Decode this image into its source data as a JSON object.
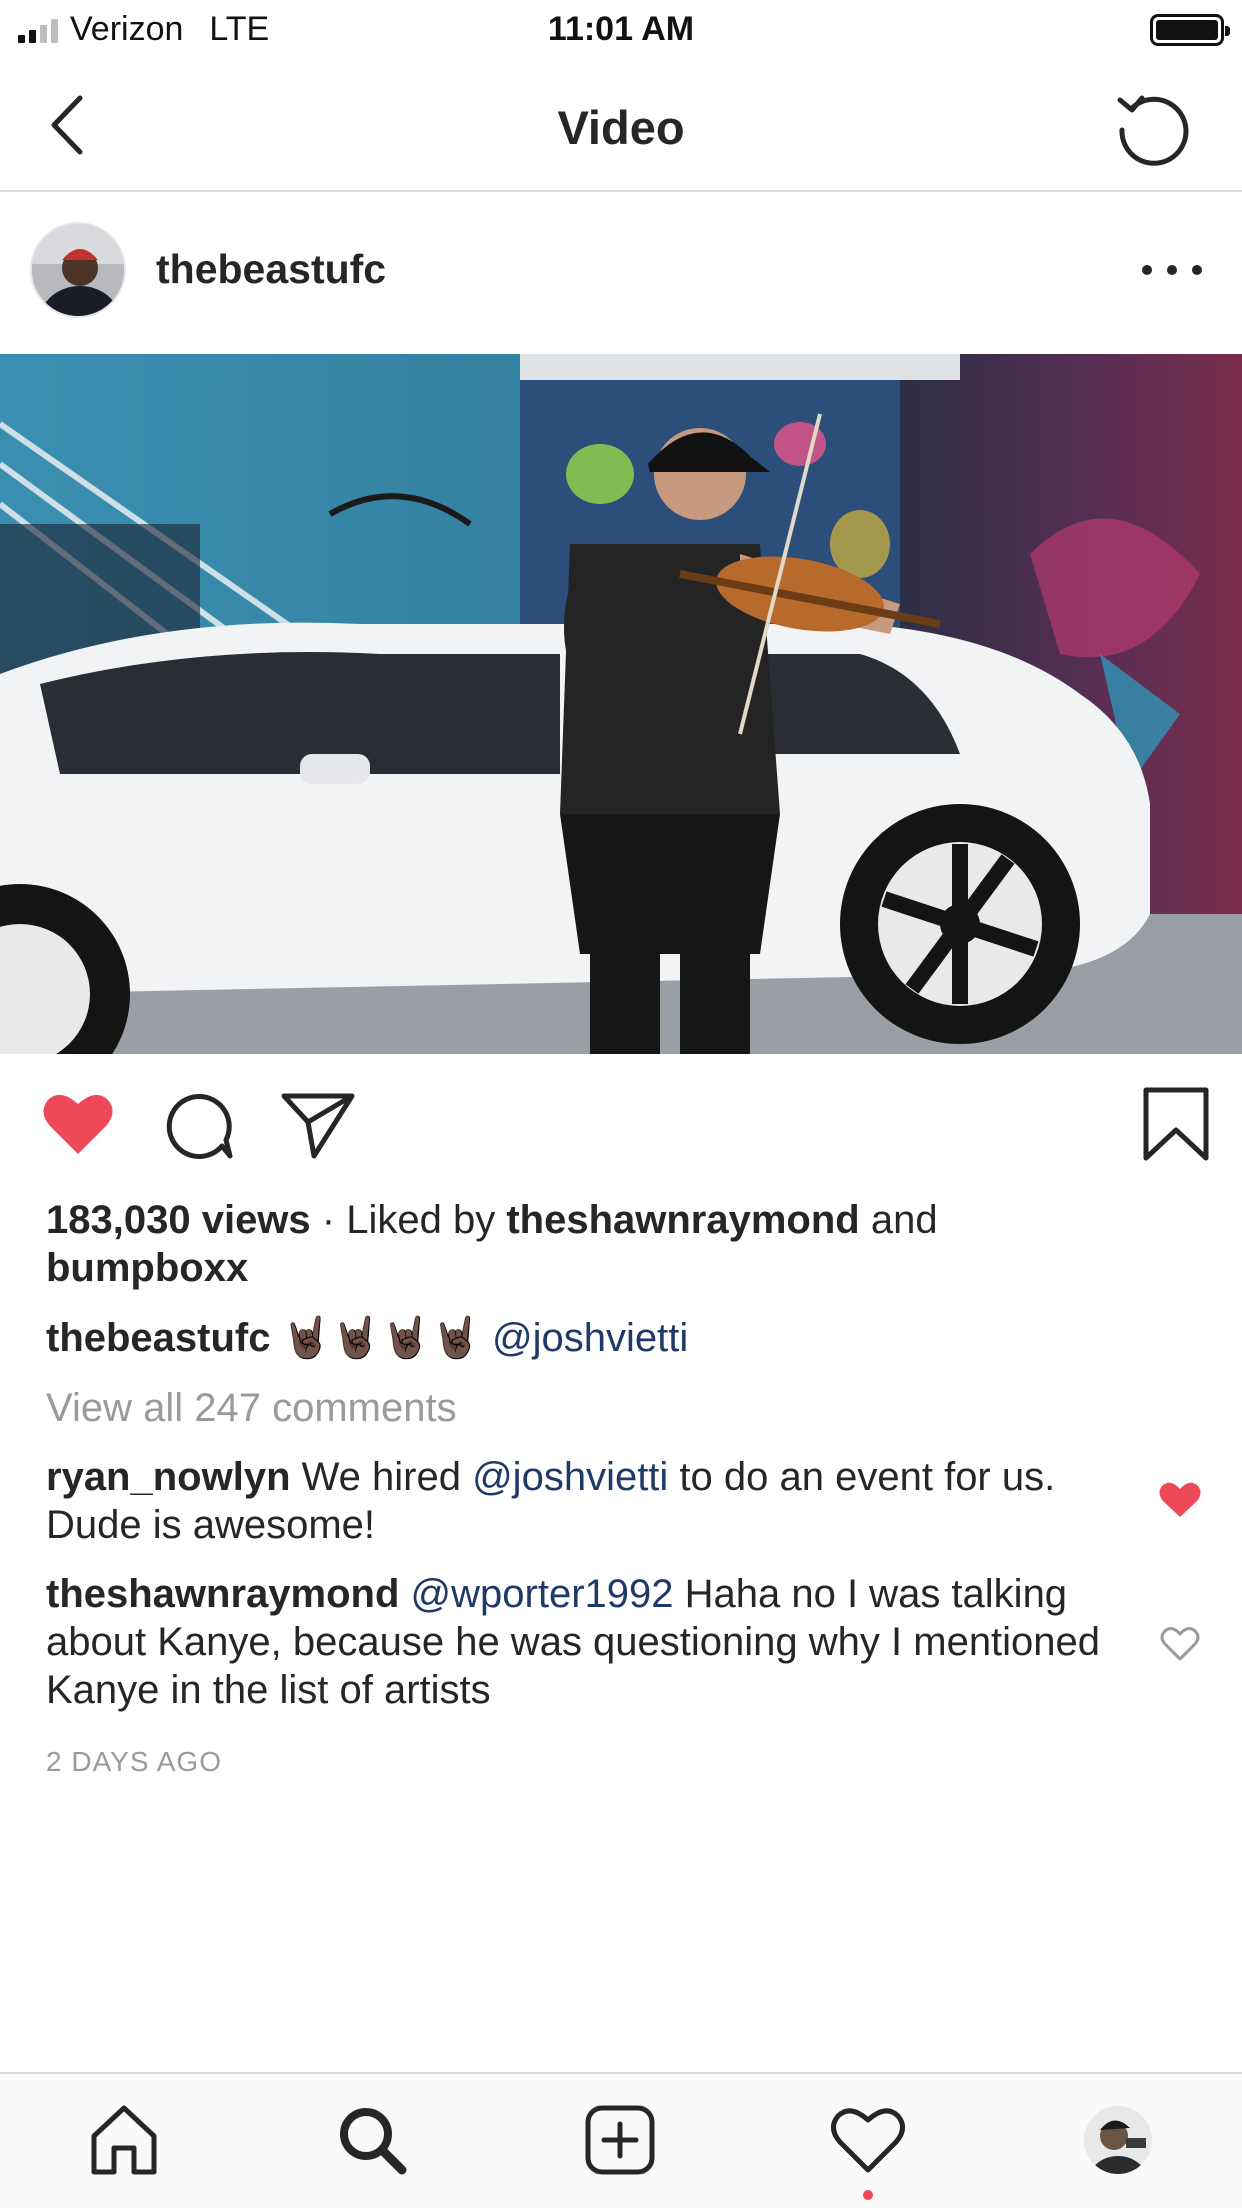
{
  "status_bar": {
    "carrier": "Verizon",
    "network": "LTE",
    "time": "11:01 AM"
  },
  "header": {
    "title": "Video",
    "back_icon": "chevron-left-icon",
    "refresh_icon": "refresh-icon"
  },
  "post": {
    "username": "thebeastufc",
    "more_icon": "more-horizontal-icon",
    "liked": true,
    "views": "183,030 views",
    "liked_by_prefix": " · Liked by ",
    "liked_by_user": "theshawnraymond",
    "liked_by_and": " and",
    "liked_by_user2": "bumpboxx",
    "caption": {
      "user": "thebeastufc",
      "emojis": "🤘🏿🤘🏿🤘🏿🤘🏿",
      "mention": "@joshvietti"
    },
    "view_all": "View all 247 comments",
    "comments": [
      {
        "user": "ryan_nowlyn",
        "text_before": " We hired ",
        "mention": "@joshvietti",
        "text_after": "  to do an event for us. Dude is awesome!",
        "liked": true
      },
      {
        "user": "theshawnraymond",
        "mention": "@wporter1992",
        "text_after": " Haha no I was talking about Kanye, because he was questioning why I mentioned Kanye in the list of artists",
        "liked": false
      }
    ],
    "timestamp": "2 DAYS AGO"
  },
  "colors": {
    "heart_red": "#ed4956",
    "mention_blue": "#1f3a68",
    "meta_grey": "#9a9a9a"
  },
  "tab_bar": {
    "items": [
      "home-icon",
      "search-icon",
      "add-post-icon",
      "activity-heart-icon",
      "profile-avatar"
    ],
    "active": "search-icon"
  }
}
